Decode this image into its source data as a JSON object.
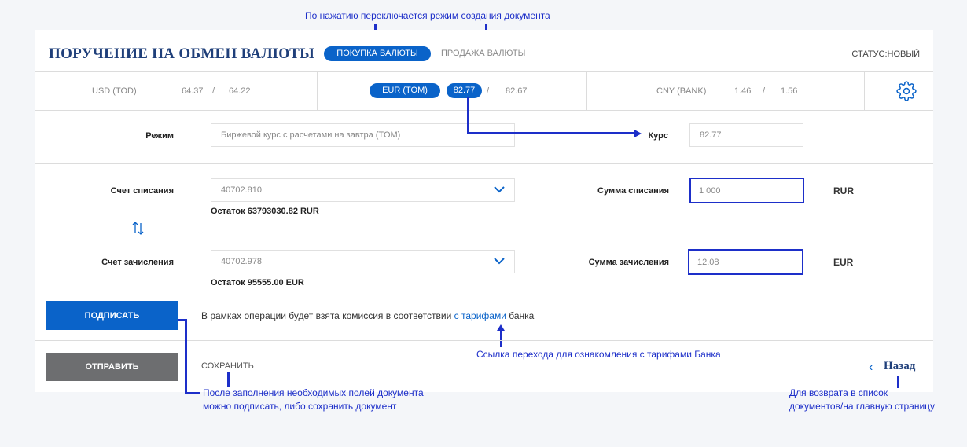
{
  "annotations": {
    "mode_switch": "По нажатию переключается режим создания документа",
    "tariff_link": "Ссылка перехода для ознакомления с тарифами Банка",
    "after_fill_1": "После заполнения необходимых полей документа",
    "after_fill_2": "можно подписать, либо сохранить документ",
    "back_1": "Для возврата в список",
    "back_2": "документов/на главную страницу"
  },
  "header": {
    "title": "ПОРУЧЕНИЕ НА ОБМЕН ВАЛЮТЫ",
    "tab_buy": "ПОКУПКА ВАЛЮТЫ",
    "tab_sell": "ПРОДАЖА ВАЛЮТЫ",
    "status": "СТАТУС:НОВЫЙ"
  },
  "rates": [
    {
      "pair": "USD (TOD)",
      "buy": "64.37",
      "sep": "/",
      "sell": "64.22"
    },
    {
      "pair": "EUR (TOM)",
      "buy": "82.77",
      "sep": "/",
      "sell": "82.67"
    },
    {
      "pair": "CNY (BANK)",
      "buy": "1.46",
      "sep": "/",
      "sell": "1.56"
    }
  ],
  "form": {
    "mode_label": "Режим",
    "mode_value": "Биржевой курс с расчетами на завтра (TOM)",
    "rate_label": "Курс",
    "rate_value": "82.77",
    "debit_account_label": "Счет списания",
    "debit_account_value": "40702.810",
    "debit_balance": "Остаток 63793030.82 RUR",
    "debit_amount_label": "Сумма списания",
    "debit_amount_value": "1 000",
    "debit_currency": "RUR",
    "credit_account_label": "Счет зачисления",
    "credit_account_value": "40702.978",
    "credit_balance": "Остаток 95555.00 EUR",
    "credit_amount_label": "Сумма зачисления",
    "credit_amount_value": "12.08",
    "credit_currency": "EUR"
  },
  "actions": {
    "sign": "ПОДПИСАТЬ",
    "commission_pre": "В рамках операции будет взята комиссия в соответствии ",
    "commission_link": "с тарифами",
    "commission_post": " банка",
    "send": "ОТПРАВИТЬ",
    "save": "СОХРАНИТЬ",
    "back_arrow": "‹",
    "back": "Назад"
  },
  "colors": {
    "accent": "#0a63c9",
    "title": "#1f3f7a",
    "annotation": "#1d2fc9",
    "send_button": "#6d6e70"
  }
}
